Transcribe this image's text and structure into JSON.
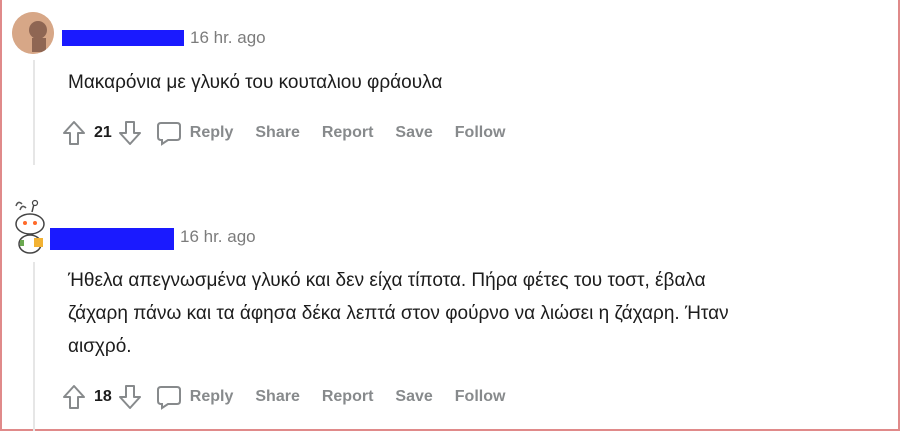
{
  "comments": [
    {
      "timestamp": "16 hr. ago",
      "text_lines": [
        "Μακαρόνια με γλυκό του κουταλιου φράουλα"
      ],
      "votes": "21",
      "actions": {
        "reply": "Reply",
        "share": "Share",
        "report": "Report",
        "save": "Save",
        "follow": "Follow"
      }
    },
    {
      "timestamp": "16 hr. ago",
      "text_lines": [
        "Ήθελα απεγνωσμένα γλυκό και δεν είχα τίποτα. Πήρα φέτες του τοστ, έβαλα",
        "ζάχαρη πάνω και τα άφησα δέκα λεπτά στον φούρνο να λιώσει η ζάχαρη. Ήταν",
        "αισχρό."
      ],
      "votes": "18",
      "actions": {
        "reply": "Reply",
        "share": "Share",
        "report": "Report",
        "save": "Save",
        "follow": "Follow"
      }
    }
  ],
  "colors": {
    "redaction": "#1a1aff",
    "meta_text": "#7c7c7c",
    "action_text": "#878a8c"
  }
}
